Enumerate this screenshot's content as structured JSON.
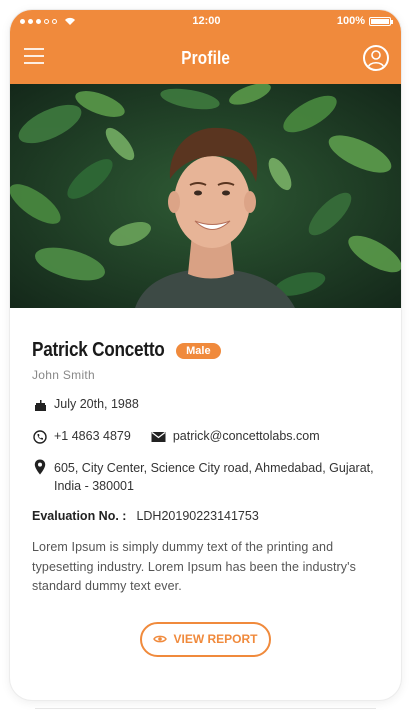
{
  "status_bar": {
    "time": "12:00",
    "battery": "100%"
  },
  "header": {
    "title": "Profile",
    "menu_icon": "menu-icon",
    "user_icon": "user-icon"
  },
  "profile": {
    "name": "Patrick Concetto",
    "gender": "Male",
    "subname": "John Smith",
    "dob": "July 20th, 1988",
    "phone": "+1 4863 4879",
    "email": "patrick@concettolabs.com",
    "address": "605, City Center, Science City road, Ahmedabad, Gujarat, India - 380001",
    "evaluation_label": "Evaluation No. :",
    "evaluation_value": "LDH20190223141753",
    "description": "Lorem Ipsum is simply dummy text of the printing and typesetting industry. Lorem Ipsum has been the industry's standard dummy text ever."
  },
  "actions": {
    "view_report": "VIEW REPORT"
  },
  "colors": {
    "accent": "#f08a3c"
  }
}
